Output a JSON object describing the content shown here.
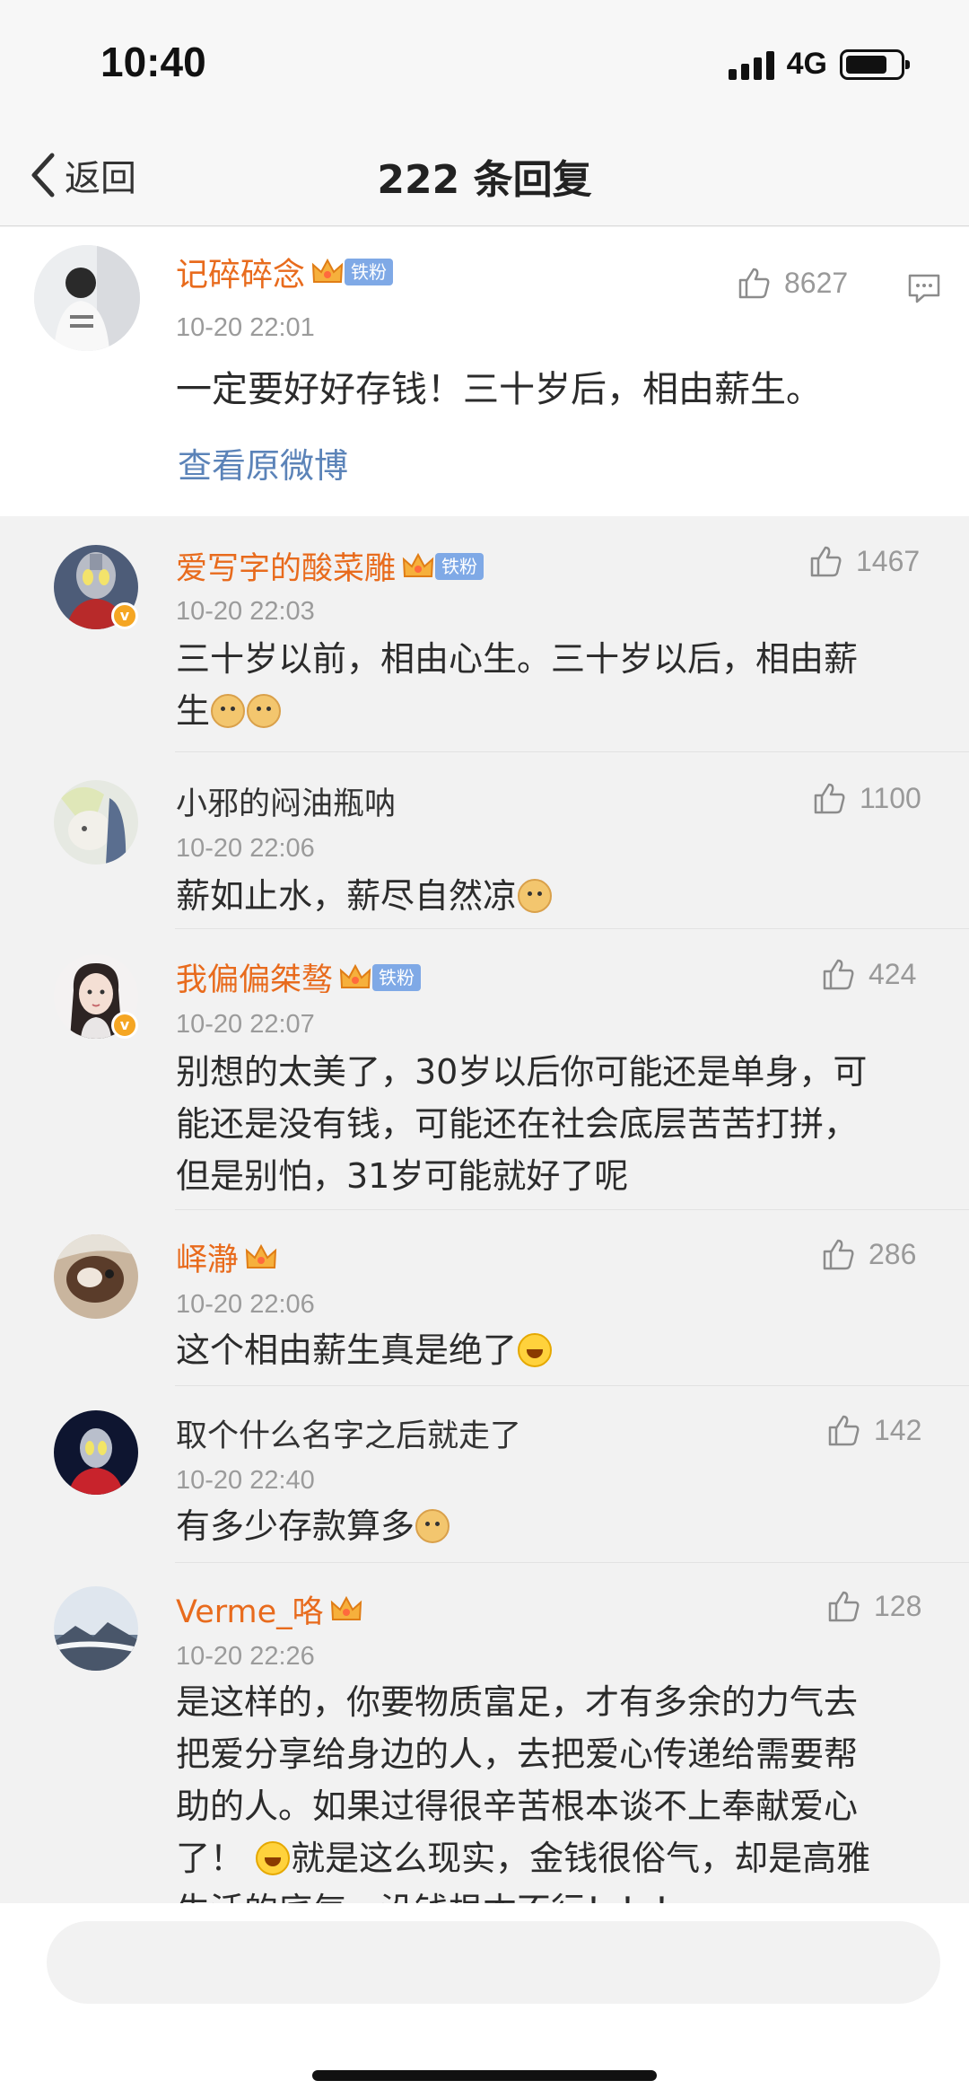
{
  "status_bar": {
    "time": "10:40",
    "network": "4G",
    "battery_level": 0.78
  },
  "nav": {
    "back_label": "返回",
    "title": "222 条回复"
  },
  "original": {
    "username": "记碎碎念",
    "fan_badge": "铁粉",
    "time": "10-20 22:01",
    "text": "一定要好好存钱！三十岁后，相由薪生。",
    "likes": "8627",
    "view_original": "查看原微博"
  },
  "replies": [
    {
      "username": "爱写字的酸菜雕",
      "badge": "铁粉",
      "time": "10-20 22:03",
      "likes": "1467",
      "line1": "三十岁以前，相由心生。三十岁以后，相由薪",
      "line2": "生"
    },
    {
      "username": "小邪的闷油瓶呐",
      "time": "10-20 22:06",
      "likes": "1100",
      "line1": "薪如止水，薪尽自然凉"
    },
    {
      "username": "我偏偏桀骜",
      "badge": "铁粉",
      "time": "10-20 22:07",
      "likes": "424",
      "line1": "别想的太美了，30岁以后你可能还是单身，可",
      "line2": "能还是没有钱，可能还在社会底层苦苦打拼，",
      "line3": "但是别怕，31岁可能就好了呢"
    },
    {
      "username": "峄瀞",
      "time": "10-20 22:06",
      "likes": "286",
      "line1": "这个相由薪生真是绝了"
    },
    {
      "username": "取个什么名字之后就走了",
      "time": "10-20 22:40",
      "likes": "142",
      "line1": "有多少存款算多"
    },
    {
      "username": "Verme_咯",
      "time": "10-20 22:26",
      "likes": "128",
      "line1": "是这样的，你要物质富足，才有多余的力气去",
      "line2": "把爱分享给身边的人，去把爱心传递给需要帮",
      "line3": "助的人。如果过得很辛苦根本谈不上奉献爱心",
      "line4_a": "了！",
      "line4_b": "就是这么现实，金钱很俗气，却是高雅",
      "line5": "生活的底气，没钱根本不行！！！"
    }
  ]
}
